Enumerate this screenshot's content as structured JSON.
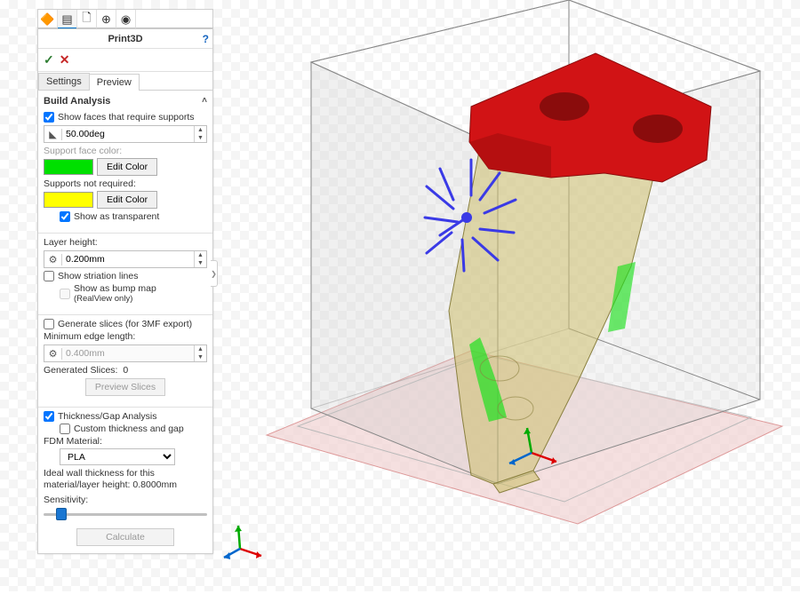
{
  "header": {
    "title": "Print3D",
    "help": "?"
  },
  "confirm": {
    "ok": "✓",
    "cancel": "✕"
  },
  "subtabs": {
    "settings": "Settings",
    "preview": "Preview"
  },
  "build": {
    "title": "Build Analysis",
    "show_supports_label": "Show faces that require supports",
    "angle_value": "50.00deg",
    "support_face_color_label": "Support face color:",
    "edit_color_btn": "Edit Color",
    "supports_not_required_label": "Supports not required:",
    "show_transparent_label": "Show as transparent"
  },
  "layer": {
    "title": "Layer height:",
    "value": "0.200mm",
    "striation_label": "Show striation lines",
    "bump_label": "Show as bump map",
    "bump_sub": "(RealView only)"
  },
  "slices": {
    "generate_label": "Generate slices (for 3MF export)",
    "min_edge_label": "Minimum edge length:",
    "min_edge_value": "0.400mm",
    "generated_label": "Generated Slices:",
    "generated_count": "0",
    "preview_btn": "Preview Slices"
  },
  "thickness": {
    "analysis_label": "Thickness/Gap Analysis",
    "custom_label": "Custom thickness and gap",
    "material_label": "FDM Material:",
    "material_value": "PLA",
    "ideal_text": "Ideal wall thickness for this material/layer height: 0.8000mm",
    "sensitivity_label": "Sensitivity:"
  },
  "calculate_btn": "Calculate",
  "colors": {
    "support": "#00e000",
    "not_required": "#ffff00"
  }
}
